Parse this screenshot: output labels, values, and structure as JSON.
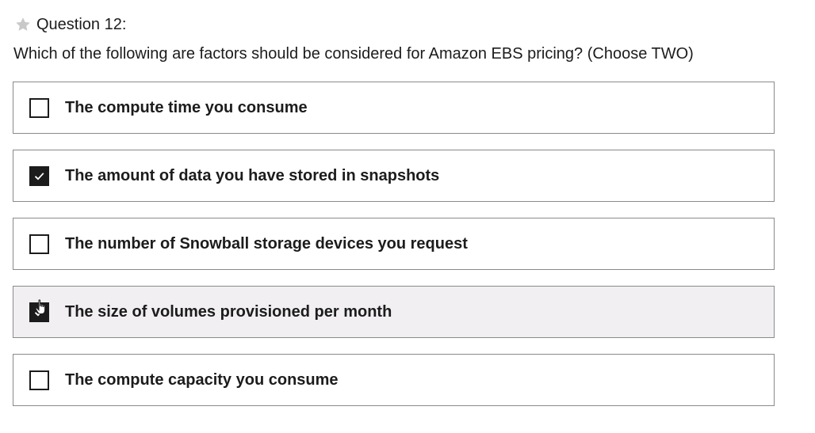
{
  "question": {
    "number_label": "Question 12:",
    "star_icon": "star-icon",
    "text": "Which of the following are factors should be considered for Amazon EBS pricing? (Choose TWO)"
  },
  "options": [
    {
      "label": "The compute time you consume",
      "checked": false
    },
    {
      "label": "The amount of data you have stored in snapshots",
      "checked": true
    },
    {
      "label": "The number of Snowball storage devices you request",
      "checked": false
    },
    {
      "label": "The size of volumes provisioned per month",
      "checked": true,
      "hovered": true
    },
    {
      "label": "The compute capacity you consume",
      "checked": false
    }
  ],
  "colors": {
    "text": "#1c1c1c",
    "border": "#8a8a8a",
    "hover_bg": "#f1eff2",
    "star": "#c9c9c9"
  },
  "cursor_icon": "hand-pointer-icon"
}
